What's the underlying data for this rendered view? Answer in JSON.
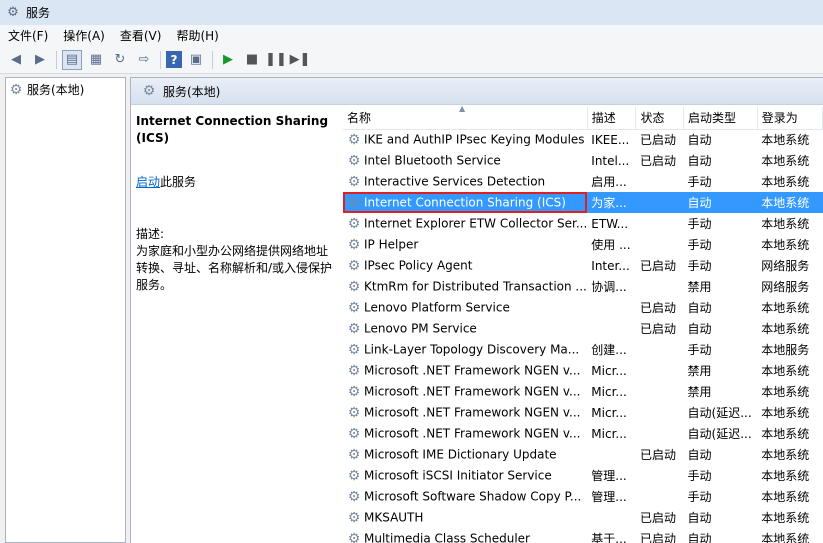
{
  "window": {
    "title": "服务"
  },
  "menu": [
    "文件(F)",
    "操作(A)",
    "查看(V)",
    "帮助(H)"
  ],
  "left_tree": {
    "node_label": "服务(本地)"
  },
  "main_header": {
    "title": "服务(本地)"
  },
  "detail": {
    "service_name": "Internet Connection Sharing (ICS)",
    "start_link": "启动",
    "start_suffix": "此服务",
    "desc_label": "描述:",
    "desc_text": "为家庭和小型办公网络提供网络地址转换、寻址、名称解析和/或入侵保护服务。"
  },
  "columns": {
    "name": "名称",
    "description": "描述",
    "status": "状态",
    "startup": "启动类型",
    "logon": "登录为"
  },
  "rows": [
    {
      "name": "IKE and AuthIP IPsec Keying Modules",
      "description": "IKEE...",
      "status": "已启动",
      "startup": "自动",
      "logon": "本地系统"
    },
    {
      "name": "Intel Bluetooth Service",
      "description": "Intel...",
      "status": "已启动",
      "startup": "自动",
      "logon": "本地系统"
    },
    {
      "name": "Interactive Services Detection",
      "description": "启用...",
      "status": "",
      "startup": "手动",
      "logon": "本地系统"
    },
    {
      "name": "Internet Connection Sharing (ICS)",
      "description": "为家...",
      "status": "",
      "startup": "自动",
      "logon": "本地系统"
    },
    {
      "name": "Internet Explorer ETW Collector Ser...",
      "description": "ETW...",
      "status": "",
      "startup": "手动",
      "logon": "本地系统"
    },
    {
      "name": "IP Helper",
      "description": "使用 ...",
      "status": "",
      "startup": "手动",
      "logon": "本地系统"
    },
    {
      "name": "IPsec Policy Agent",
      "description": "Inter...",
      "status": "已启动",
      "startup": "手动",
      "logon": "网络服务"
    },
    {
      "name": "KtmRm for Distributed Transaction ...",
      "description": "协调...",
      "status": "",
      "startup": "禁用",
      "logon": "网络服务"
    },
    {
      "name": "Lenovo Platform Service",
      "description": "",
      "status": "已启动",
      "startup": "自动",
      "logon": "本地系统"
    },
    {
      "name": "Lenovo PM Service",
      "description": "",
      "status": "已启动",
      "startup": "自动",
      "logon": "本地系统"
    },
    {
      "name": "Link-Layer Topology Discovery Ma...",
      "description": "创建...",
      "status": "",
      "startup": "手动",
      "logon": "本地服务"
    },
    {
      "name": "Microsoft .NET Framework NGEN v...",
      "description": "Micr...",
      "status": "",
      "startup": "禁用",
      "logon": "本地系统"
    },
    {
      "name": "Microsoft .NET Framework NGEN v...",
      "description": "Micr...",
      "status": "",
      "startup": "禁用",
      "logon": "本地系统"
    },
    {
      "name": "Microsoft .NET Framework NGEN v...",
      "description": "Micr...",
      "status": "",
      "startup": "自动(延迟...",
      "logon": "本地系统"
    },
    {
      "name": "Microsoft .NET Framework NGEN v...",
      "description": "Micr...",
      "status": "",
      "startup": "自动(延迟...",
      "logon": "本地系统"
    },
    {
      "name": "Microsoft IME Dictionary Update",
      "description": "",
      "status": "已启动",
      "startup": "自动",
      "logon": "本地系统"
    },
    {
      "name": "Microsoft iSCSI Initiator Service",
      "description": "管理...",
      "status": "",
      "startup": "手动",
      "logon": "本地系统"
    },
    {
      "name": "Microsoft Software Shadow Copy P...",
      "description": "管理...",
      "status": "",
      "startup": "手动",
      "logon": "本地系统"
    },
    {
      "name": "MKSAUTH",
      "description": "",
      "status": "已启动",
      "startup": "自动",
      "logon": "本地系统"
    },
    {
      "name": "Multimedia Class Scheduler",
      "description": "基于...",
      "status": "已启动",
      "startup": "自动",
      "logon": "本地系统"
    }
  ],
  "selected_row": "Internet Connection Sharing (ICS)",
  "colors": {
    "selection": "#3399ff",
    "highlight_box": "#e02020",
    "link": "#0066cc"
  }
}
